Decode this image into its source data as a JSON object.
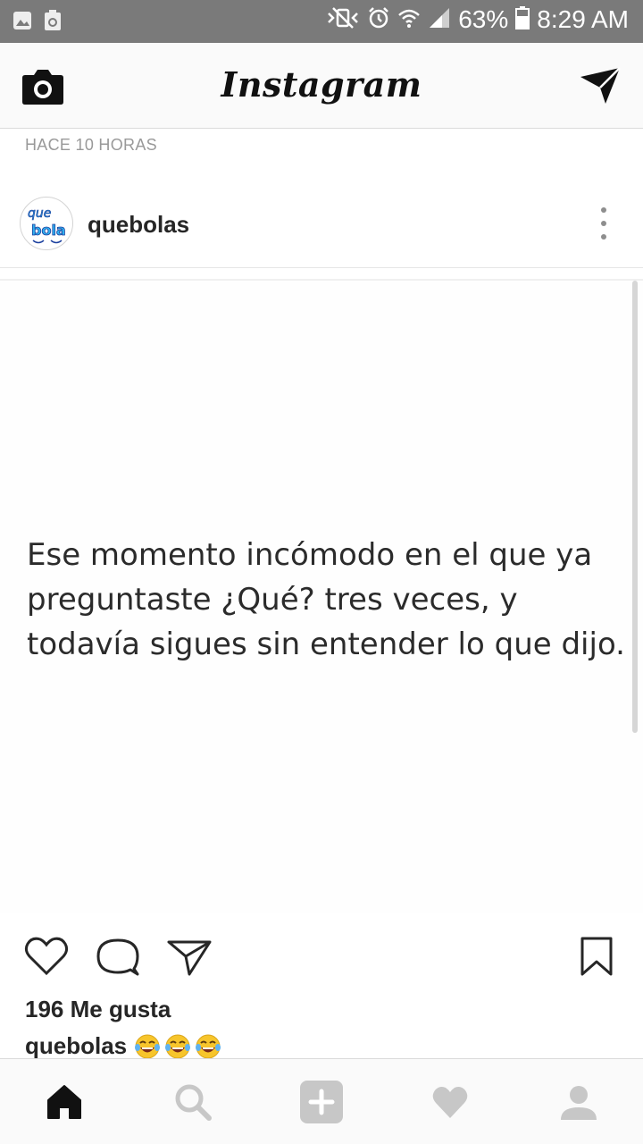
{
  "status_bar": {
    "battery": "63%",
    "time": "8:29 AM",
    "icons": [
      "gallery-notification-icon",
      "recycle-notification-icon",
      "mute-vibrate-icon",
      "alarm-icon",
      "wifi-icon",
      "signal-icon",
      "battery-icon"
    ]
  },
  "header": {
    "logo": "Instagram",
    "left_icon": "camera-icon",
    "right_icon": "direct-message-icon"
  },
  "post": {
    "timestamp": "HACE 10 HORAS",
    "username": "quebolas",
    "avatar_text": "que bola",
    "image_text": "Ese momento incómodo en el que ya preguntaste ¿Qué? tres veces, y todavía sigues sin entender lo que dijo.",
    "likes": "196 Me gusta",
    "caption_user": "quebolas",
    "caption_emojis": [
      "laughing-tears-emoji",
      "laughing-tears-emoji",
      "laughing-tears-emoji"
    ]
  },
  "actions": [
    "heart-icon",
    "comment-icon",
    "share-icon",
    "bookmark-icon"
  ],
  "bottom_nav": [
    "home-icon",
    "search-icon",
    "add-icon",
    "heart-icon",
    "profile-icon"
  ],
  "colors": {
    "status_bar": "#7a7a7a",
    "header_bg": "#fafafa",
    "text": "#262626",
    "muted": "#999999",
    "inactive_icon": "#c7c7c7",
    "emoji_yellow": "#f7c52b"
  }
}
